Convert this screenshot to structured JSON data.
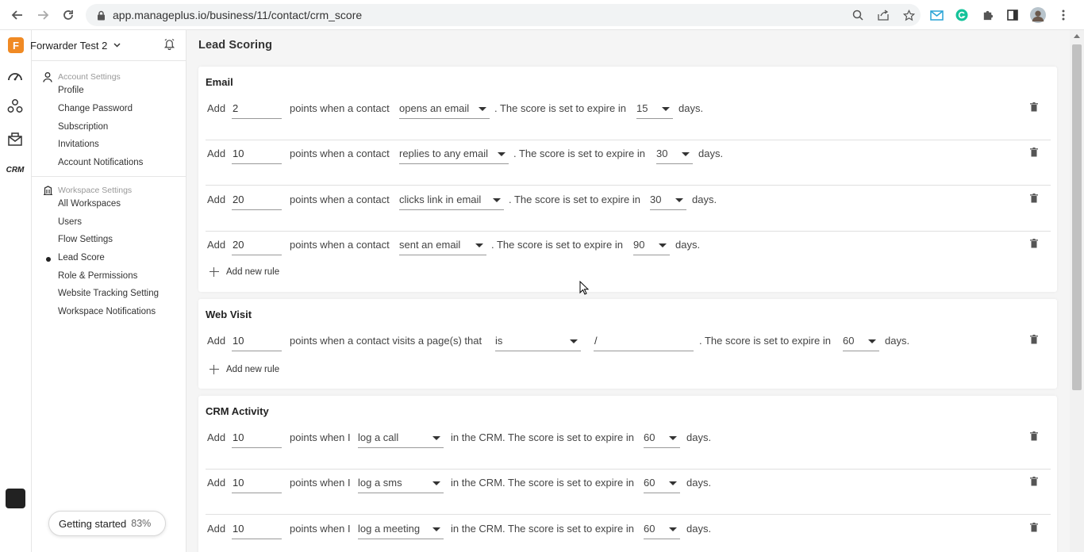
{
  "browser": {
    "url": "app.manageplus.io/business/11/contact/crm_score"
  },
  "workspace": {
    "logo_letter": "F",
    "name": "Forwarder Test 2",
    "logo_color": "#f08a24"
  },
  "sidebar": {
    "account_group_title": "Account Settings",
    "account_items": [
      {
        "label": "Profile"
      },
      {
        "label": "Change Password"
      },
      {
        "label": "Subscription"
      },
      {
        "label": "Invitations"
      },
      {
        "label": "Account Notifications"
      }
    ],
    "workspace_group_title": "Workspace Settings",
    "workspace_items": [
      {
        "label": "All Workspaces"
      },
      {
        "label": "Users"
      },
      {
        "label": "Flow Settings"
      },
      {
        "label": "Lead Score",
        "active": true
      },
      {
        "label": "Role & Permissions"
      },
      {
        "label": "Website Tracking Setting"
      },
      {
        "label": "Workspace Notifications"
      }
    ],
    "getting_started": {
      "label": "Getting started",
      "percent": "83%"
    }
  },
  "rail": {
    "icons": [
      "dashboard-icon",
      "contacts-icon",
      "campaign-icon",
      "crm-icon"
    ],
    "crm_label": "CRM"
  },
  "page": {
    "title": "Lead Scoring"
  },
  "common": {
    "add": "Add",
    "expire_text": ". The score is set to expire in",
    "days": "days.",
    "add_new_rule": "Add new rule"
  },
  "email_section": {
    "title": "Email",
    "middle_text": "points when a contact",
    "rules": [
      {
        "points": "2",
        "action": "opens an email",
        "expire": "15"
      },
      {
        "points": "10",
        "action": "replies to any email",
        "expire": "30"
      },
      {
        "points": "20",
        "action": "clicks link in email",
        "expire": "30"
      },
      {
        "points": "20",
        "action": "sent an email",
        "expire": "90"
      }
    ]
  },
  "web_section": {
    "title": "Web Visit",
    "middle_text": "points when a contact visits a page(s) that",
    "rules": [
      {
        "points": "10",
        "operator": "is",
        "path": "/",
        "expire": "60"
      }
    ]
  },
  "crm_section": {
    "title": "CRM Activity",
    "middle_text": "points when I",
    "crm_text": "in the CRM. The score is set to expire in",
    "rules": [
      {
        "points": "10",
        "action": "log a call",
        "expire": "60"
      },
      {
        "points": "10",
        "action": "log a sms",
        "expire": "60"
      },
      {
        "points": "10",
        "action": "log a meeting",
        "expire": "60"
      }
    ]
  }
}
